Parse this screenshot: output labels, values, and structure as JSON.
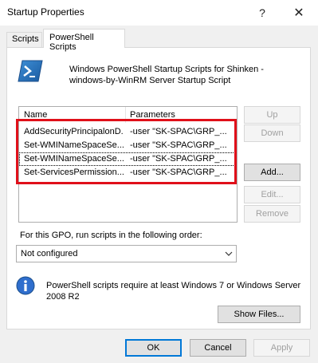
{
  "window": {
    "title": "Startup Properties",
    "help_glyph": "?",
    "close_glyph": "✕"
  },
  "tabs": [
    {
      "label": "Scripts",
      "selected": false
    },
    {
      "label": "PowerShell Scripts",
      "selected": true
    }
  ],
  "header": {
    "icon": "powershell-icon",
    "line1": "Windows PowerShell Startup Scripts for Shinken -",
    "line2": "windows-by-WinRM Server Startup Script"
  },
  "list": {
    "columns": [
      "Name",
      "Parameters"
    ],
    "rows": [
      {
        "name": "AddSecurityPrincipalonD...",
        "params": "-user \"SK-SPAC\\GRP_..."
      },
      {
        "name": "Set-WMINameSpaceSe...",
        "params": "-user \"SK-SPAC\\GRP_..."
      },
      {
        "name": "Set-WMINameSpaceSe...",
        "params": "-user \"SK-SPAC\\GRP_..."
      },
      {
        "name": "Set-ServicesPermission....",
        "params": "-user \"SK-SPAC\\GRP_..."
      }
    ]
  },
  "side_buttons": {
    "up": "Up",
    "down": "Down",
    "add": "Add...",
    "edit": "Edit...",
    "remove": "Remove"
  },
  "order": {
    "label": "For this GPO, run scripts in the following order:",
    "selected": "Not configured"
  },
  "info": {
    "icon": "info-icon",
    "text": "PowerShell scripts require at least Windows 7 or Windows Server 2008 R2"
  },
  "show_files": "Show Files...",
  "footer": {
    "ok": "OK",
    "cancel": "Cancel",
    "apply": "Apply"
  },
  "colors": {
    "highlight": "#e0101a",
    "accent": "#0078d7"
  }
}
